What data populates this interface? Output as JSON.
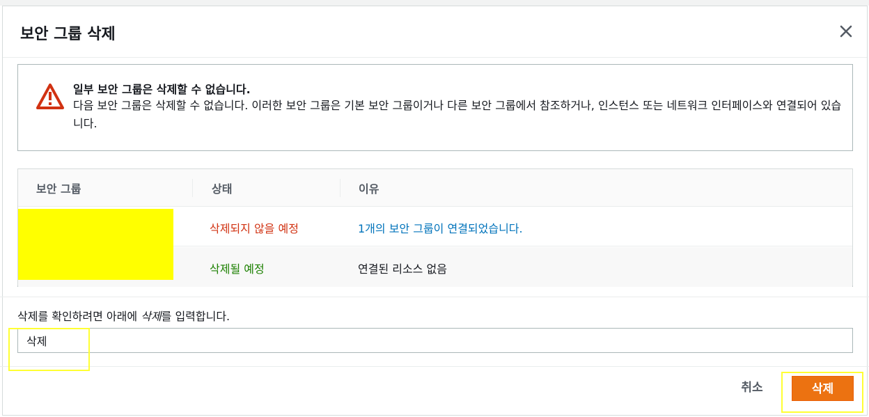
{
  "modal": {
    "title": "보안 그룹 삭제"
  },
  "alert": {
    "icon": "warning-triangle-icon",
    "title": "일부 보안 그룹은 삭제할 수 없습니다.",
    "body": "다음 보안 그룹은 삭제할 수 없습니다. 이러한 보안 그룹은 기본 보안 그룹이거나 다른 보안 그룹에서 참조하거나, 인스턴스 또는 네트워크 인터페이스와 연결되어 있습니다."
  },
  "table": {
    "headers": [
      "보안 그룹",
      "상태",
      "이유"
    ],
    "rows": [
      {
        "security_group": "",
        "status": "삭제되지 않을 예정",
        "status_color": "#d13212",
        "reason": "1개의 보안 그룹이 연결되었습니다.",
        "reason_is_link": true
      },
      {
        "security_group": "",
        "status": "삭제될 예정",
        "status_color": "#1d8102",
        "reason": "연결된 리소스 없음",
        "reason_is_link": false
      }
    ]
  },
  "confirm": {
    "label_prefix": "삭제를 확인하려면 아래에 ",
    "label_keyword": "삭제",
    "label_suffix": "를 입력합니다.",
    "input_value": "삭제"
  },
  "footer": {
    "cancel_label": "취소",
    "delete_label": "삭제"
  },
  "colors": {
    "primary_button": "#ec7211",
    "highlight": "#ffff00"
  }
}
